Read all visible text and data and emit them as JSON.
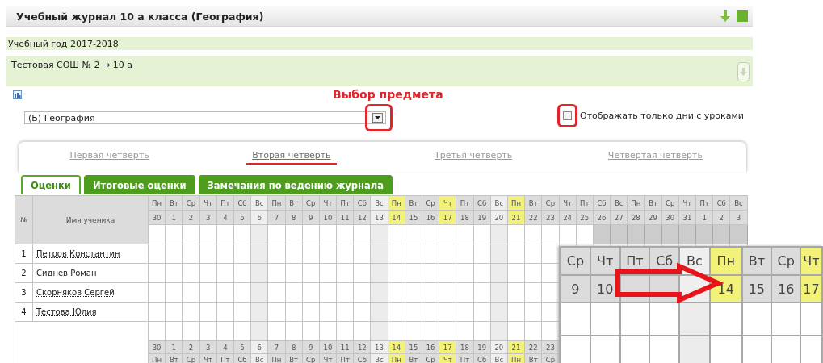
{
  "journal": {
    "title": "Учебный журнал 10 а класса (География)",
    "school_year": "Учебный год 2017-2018",
    "class_path": "Тестовая СОШ № 2 → 10 а"
  },
  "annotation": {
    "subject_hint": "Выбор предмета"
  },
  "subject_select": {
    "value": "(Б) География",
    "marked": true
  },
  "lesson_days_filter": {
    "label": "Отображать только дни с уроками",
    "checked": false,
    "marked": true
  },
  "quarters": [
    {
      "label": "Первая четверть",
      "selected": false,
      "marked": false
    },
    {
      "label": "Вторая четверть",
      "selected": true,
      "marked": true
    },
    {
      "label": "Третья четверть",
      "selected": false,
      "marked": false
    },
    {
      "label": "Четвертая четверть",
      "selected": false,
      "marked": false
    }
  ],
  "tabs": [
    {
      "label": "Оценки",
      "selected": true
    },
    {
      "label": "Итоговые оценки",
      "selected": false
    },
    {
      "label": "Замечания по ведению журнала",
      "selected": false
    }
  ],
  "table": {
    "columns": [
      "№",
      "Имя ученика"
    ],
    "days": [
      {
        "weekday": "Пн",
        "date": "30",
        "kind": "weekday",
        "closed": false
      },
      {
        "weekday": "Вт",
        "date": "1",
        "kind": "weekday",
        "closed": false
      },
      {
        "weekday": "Ср",
        "date": "2",
        "kind": "weekday",
        "closed": false
      },
      {
        "weekday": "Чт",
        "date": "3",
        "kind": "weekday",
        "closed": false
      },
      {
        "weekday": "Пт",
        "date": "4",
        "kind": "weekday",
        "closed": false
      },
      {
        "weekday": "Сб",
        "date": "5",
        "kind": "weekday",
        "closed": false
      },
      {
        "weekday": "Вс",
        "date": "6",
        "kind": "sunday",
        "closed": false
      },
      {
        "weekday": "Пн",
        "date": "7",
        "kind": "weekday",
        "closed": false
      },
      {
        "weekday": "Вт",
        "date": "8",
        "kind": "weekday",
        "closed": false
      },
      {
        "weekday": "Ср",
        "date": "9",
        "kind": "weekday",
        "closed": false
      },
      {
        "weekday": "Чт",
        "date": "10",
        "kind": "weekday",
        "closed": false
      },
      {
        "weekday": "Пт",
        "date": "11",
        "kind": "weekday",
        "closed": false
      },
      {
        "weekday": "Сб",
        "date": "12",
        "kind": "weekday",
        "closed": false
      },
      {
        "weekday": "Вс",
        "date": "13",
        "kind": "sunday",
        "closed": false
      },
      {
        "weekday": "Пн",
        "date": "14",
        "kind": "lesson",
        "closed": false
      },
      {
        "weekday": "Вт",
        "date": "15",
        "kind": "weekday",
        "closed": false
      },
      {
        "weekday": "Ср",
        "date": "16",
        "kind": "weekday",
        "closed": false
      },
      {
        "weekday": "Чт",
        "date": "17",
        "kind": "lesson",
        "closed": false
      },
      {
        "weekday": "Пт",
        "date": "18",
        "kind": "weekday",
        "closed": false
      },
      {
        "weekday": "Сб",
        "date": "19",
        "kind": "weekday",
        "closed": false
      },
      {
        "weekday": "Вс",
        "date": "20",
        "kind": "sunday",
        "closed": false
      },
      {
        "weekday": "Пн",
        "date": "21",
        "kind": "lesson",
        "closed": false
      },
      {
        "weekday": "Вт",
        "date": "22",
        "kind": "weekday",
        "closed": false
      },
      {
        "weekday": "Ср",
        "date": "23",
        "kind": "weekday",
        "closed": false
      },
      {
        "weekday": "Чт",
        "date": "24",
        "kind": "weekday",
        "closed": false
      },
      {
        "weekday": "Пт",
        "date": "25",
        "kind": "weekday",
        "closed": false
      },
      {
        "weekday": "Сб",
        "date": "26",
        "kind": "weekday",
        "closed": true
      },
      {
        "weekday": "Вс",
        "date": "27",
        "kind": "weekday",
        "closed": true
      },
      {
        "weekday": "Пн",
        "date": "28",
        "kind": "weekday",
        "closed": true
      },
      {
        "weekday": "Вт",
        "date": "29",
        "kind": "weekday",
        "closed": true
      },
      {
        "weekday": "Ср",
        "date": "30",
        "kind": "weekday",
        "closed": true
      },
      {
        "weekday": "Чт",
        "date": "31",
        "kind": "weekday",
        "closed": true
      },
      {
        "weekday": "Пт",
        "date": "1",
        "kind": "weekday",
        "closed": true
      },
      {
        "weekday": "Сб",
        "date": "2",
        "kind": "weekday",
        "closed": true
      },
      {
        "weekday": "Вс",
        "date": "3",
        "kind": "weekday",
        "closed": true
      }
    ],
    "rows": [
      {
        "number": "1",
        "name": "Петров Константин"
      },
      {
        "number": "2",
        "name": "Сиднев Роман"
      },
      {
        "number": "3",
        "name": "Скорняков Сергей"
      },
      {
        "number": "4",
        "name": "Тестова Юлия"
      }
    ],
    "footer_days": [
      {
        "date": "30",
        "weekday": "Пн",
        "kind": "weekday"
      },
      {
        "date": "1",
        "weekday": "Вт",
        "kind": "weekday"
      },
      {
        "date": "2",
        "weekday": "Ср",
        "kind": "weekday"
      },
      {
        "date": "3",
        "weekday": "Чт",
        "kind": "weekday"
      },
      {
        "date": "4",
        "weekday": "Пт",
        "kind": "weekday"
      },
      {
        "date": "5",
        "weekday": "Сб",
        "kind": "weekday"
      },
      {
        "date": "6",
        "weekday": "Вс",
        "kind": "sunday"
      },
      {
        "date": "7",
        "weekday": "Пн",
        "kind": "weekday"
      },
      {
        "date": "8",
        "weekday": "Вт",
        "kind": "weekday"
      },
      {
        "date": "9",
        "weekday": "Ср",
        "kind": "weekday"
      },
      {
        "date": "10",
        "weekday": "Чт",
        "kind": "weekday"
      },
      {
        "date": "11",
        "weekday": "Пт",
        "kind": "weekday"
      },
      {
        "date": "12",
        "weekday": "Сб",
        "kind": "weekday"
      },
      {
        "date": "13",
        "weekday": "Вс",
        "kind": "sunday"
      },
      {
        "date": "14",
        "weekday": "Пн",
        "kind": "lesson"
      },
      {
        "date": "15",
        "weekday": "Вт",
        "kind": "weekday"
      },
      {
        "date": "16",
        "weekday": "Ср",
        "kind": "weekday"
      },
      {
        "date": "17",
        "weekday": "Чт",
        "kind": "lesson"
      },
      {
        "date": "18",
        "weekday": "Пт",
        "kind": "weekday"
      },
      {
        "date": "19",
        "weekday": "Сб",
        "kind": "weekday"
      },
      {
        "date": "20",
        "weekday": "Вс",
        "kind": "sunday"
      },
      {
        "date": "21",
        "weekday": "Пн",
        "kind": "lesson"
      },
      {
        "date": "22",
        "weekday": "Вт",
        "kind": "weekday"
      },
      {
        "date": "23",
        "weekday": "Ср",
        "kind": "weekday"
      }
    ]
  },
  "zoom_inset": {
    "days": [
      {
        "weekday": "Ср",
        "date": "9",
        "kind": "weekday"
      },
      {
        "weekday": "Чт",
        "date": "10",
        "kind": "weekday"
      },
      {
        "weekday": "Пт",
        "kind": "weekday"
      },
      {
        "weekday": "Сб",
        "kind": "weekday"
      },
      {
        "weekday": "Вс",
        "kind": "sunday"
      },
      {
        "weekday": "Пн",
        "date": "14",
        "kind": "lesson"
      },
      {
        "weekday": "Вт",
        "date": "15",
        "kind": "weekday"
      },
      {
        "weekday": "Ср",
        "date": "16",
        "kind": "weekday"
      },
      {
        "weekday": "Чт",
        "date": "17",
        "kind": "lesson"
      }
    ]
  }
}
